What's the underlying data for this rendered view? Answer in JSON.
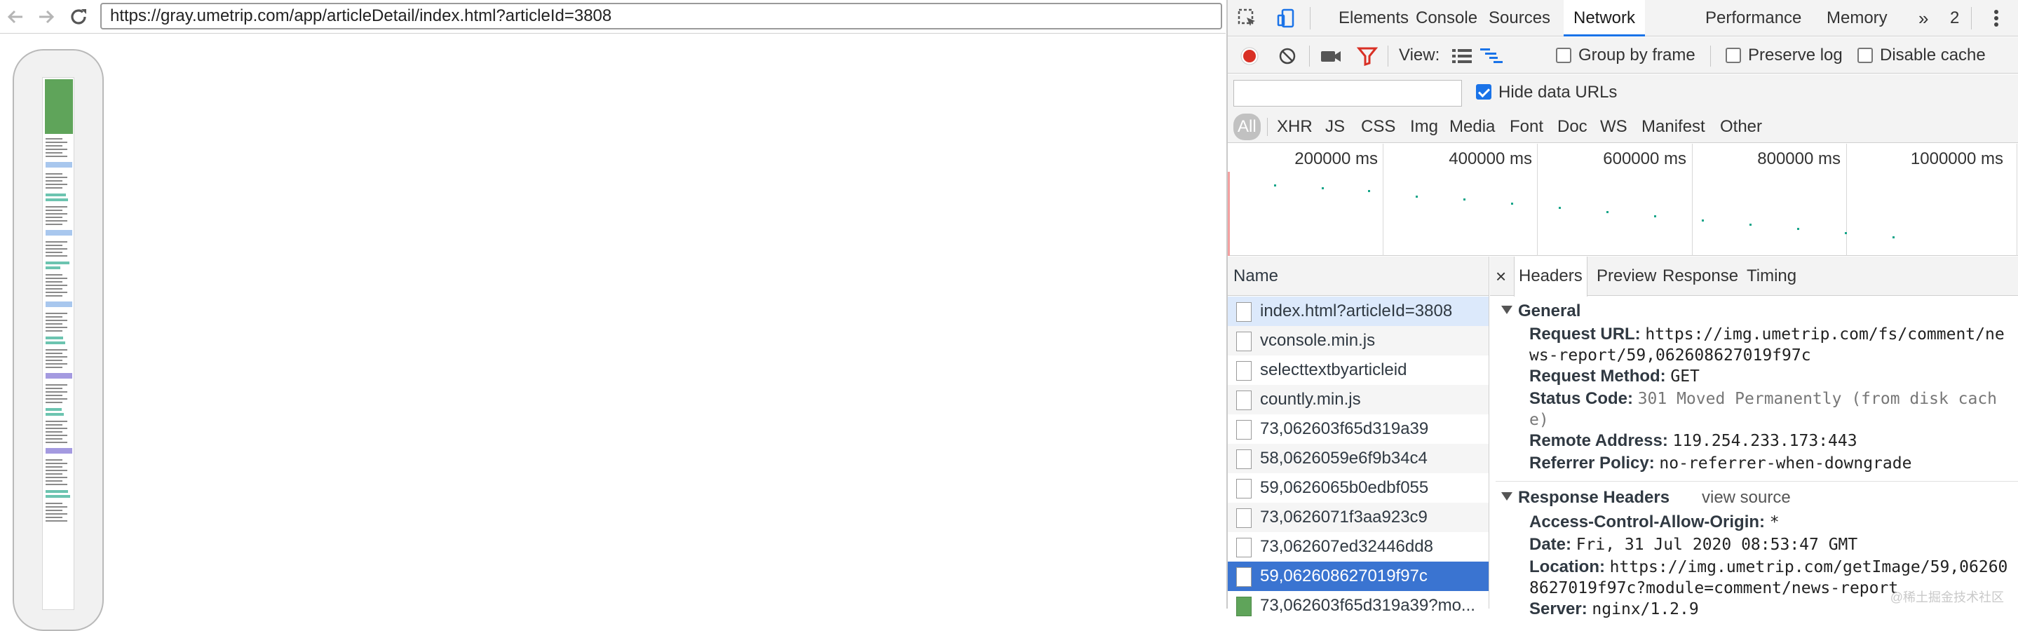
{
  "browser": {
    "url": "https://gray.umetrip.com/app/articleDetail/index.html?articleId=3808",
    "nav_icons": [
      "back-arrow-icon",
      "forward-arrow-icon",
      "reload-icon"
    ]
  },
  "devtools": {
    "tabs": [
      "Elements",
      "Console",
      "Sources",
      "Network",
      "Performance",
      "Memory"
    ],
    "active_tab": "Network",
    "overflow": "»",
    "error_count": "2",
    "toolbar": {
      "view_label": "View:",
      "group_by_frame": "Group by frame",
      "preserve_log": "Preserve log",
      "disable_cache": "Disable cache"
    },
    "filter": {
      "placeholder": "",
      "hide_data_urls": "Hide data URLs",
      "hide_data_urls_checked": true
    },
    "types": [
      "All",
      "XHR",
      "JS",
      "CSS",
      "Img",
      "Media",
      "Font",
      "Doc",
      "WS",
      "Manifest",
      "Other"
    ],
    "active_type": "All",
    "timeline_labels": [
      "200000 ms",
      "400000 ms",
      "600000 ms",
      "800000 ms",
      "1000000 ms"
    ],
    "name_header": "Name",
    "requests": [
      "index.html?articleId=3808",
      "vconsole.min.js",
      "selecttextbyarticleid",
      "countly.min.js",
      "73,062603f65d319a39",
      "58,0626059e6f9b34c4",
      "59,0626065b0edbf055",
      "73,0626071f3aa923c9",
      "73,062607ed32446dd8",
      "59,062608627019f97c",
      "73,062603f65d319a39?mo..."
    ],
    "selected_request_index": 9,
    "detail": {
      "close": "×",
      "tabs": [
        "Headers",
        "Preview",
        "Response",
        "Timing"
      ],
      "active_tab": "Headers",
      "general_title": "General",
      "general": [
        {
          "k": "Request URL:",
          "v": "https://img.umetrip.com/fs/comment/news-report/59,062608627019f97c"
        },
        {
          "k": "Request Method:",
          "v": "GET"
        },
        {
          "k": "Status Code:",
          "v": "301 Moved Permanently (from disk cache)"
        },
        {
          "k": "Remote Address:",
          "v": "119.254.233.173:443"
        },
        {
          "k": "Referrer Policy:",
          "v": "no-referrer-when-downgrade"
        }
      ],
      "response_title": "Response Headers",
      "view_source": "view source",
      "response": [
        {
          "k": "Access-Control-Allow-Origin:",
          "v": "*"
        },
        {
          "k": "Date:",
          "v": "Fri, 31 Jul 2020 08:53:47 GMT"
        },
        {
          "k": "Location:",
          "v": "https://img.umetrip.com/getImage/59,062608627019f97c?module=comment/news-report"
        },
        {
          "k": "Server:",
          "v": "nginx/1.2.9"
        }
      ]
    }
  },
  "watermark": "@稀土掘金技术社区"
}
